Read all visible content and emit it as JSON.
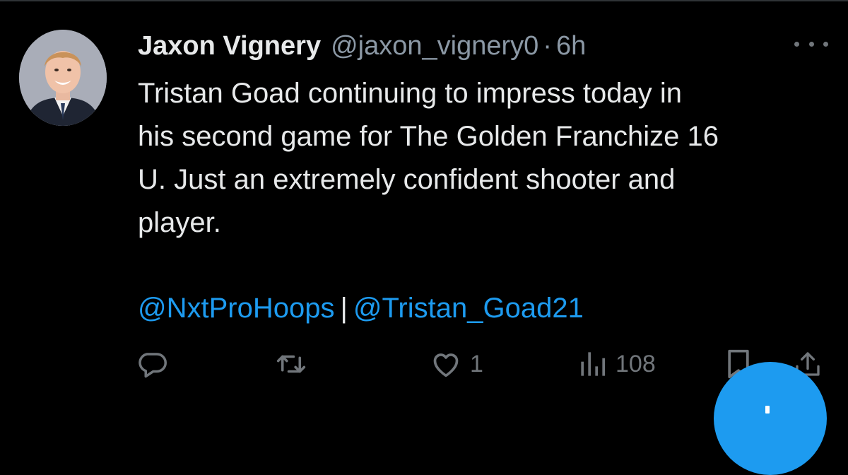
{
  "tweet": {
    "display_name": "Jaxon Vignery",
    "handle": "@jaxon_vignery0",
    "separator": "·",
    "time": "6h",
    "text_lines": [
      "Tristan Goad continuing to impress today in",
      "his second game for The Golden Franchize 16",
      "U. Just an extremely confident shooter and",
      "player."
    ],
    "mentions": [
      "@NxtProHoops",
      "@Tristan_Goad21"
    ],
    "mention_separator": "|",
    "more_icon": "more-horizontal-icon",
    "avatar": "profile-photo"
  },
  "actions": {
    "reply": {
      "icon": "reply-icon"
    },
    "retweet": {
      "icon": "retweet-icon"
    },
    "like": {
      "icon": "heart-icon",
      "count": "1"
    },
    "views": {
      "icon": "views-chart-icon",
      "count": "108"
    },
    "bookmark": {
      "icon": "bookmark-icon"
    },
    "share": {
      "icon": "share-icon"
    }
  },
  "compose_button": {
    "icon": "compose-icon"
  },
  "colors": {
    "background": "#000000",
    "text": "#e7e9ea",
    "muted": "#8b98a5",
    "icon": "#71767b",
    "accent": "#1d9bf0"
  }
}
